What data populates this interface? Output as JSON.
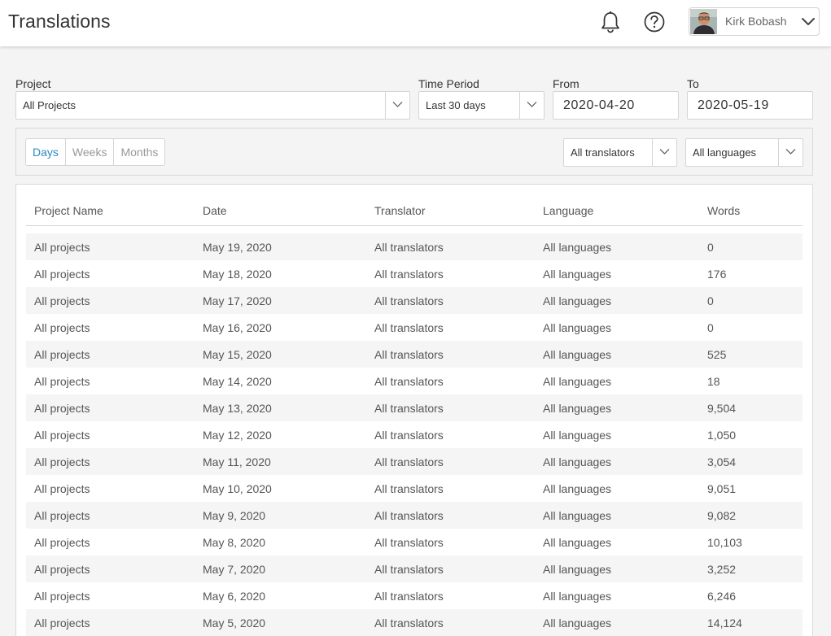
{
  "header": {
    "title": "Translations",
    "user_name": "Kirk Bobash"
  },
  "filters": {
    "project_label": "Project",
    "project_value": "All Projects",
    "time_period_label": "Time Period",
    "time_period_value": "Last 30 days",
    "from_label": "From",
    "from_value": "2020-04-20",
    "to_label": "To",
    "to_value": "2020-05-19"
  },
  "granularity": {
    "options": [
      "Days",
      "Weeks",
      "Months"
    ],
    "selected": "Days"
  },
  "translator_filter": "All translators",
  "language_filter": "All languages",
  "table": {
    "columns": [
      "Project Name",
      "Date",
      "Translator",
      "Language",
      "Words"
    ],
    "rows": [
      [
        "All projects",
        "May 19, 2020",
        "All translators",
        "All languages",
        "0"
      ],
      [
        "All projects",
        "May 18, 2020",
        "All translators",
        "All languages",
        "176"
      ],
      [
        "All projects",
        "May 17, 2020",
        "All translators",
        "All languages",
        "0"
      ],
      [
        "All projects",
        "May 16, 2020",
        "All translators",
        "All languages",
        "0"
      ],
      [
        "All projects",
        "May 15, 2020",
        "All translators",
        "All languages",
        "525"
      ],
      [
        "All projects",
        "May 14, 2020",
        "All translators",
        "All languages",
        "18"
      ],
      [
        "All projects",
        "May 13, 2020",
        "All translators",
        "All languages",
        "9,504"
      ],
      [
        "All projects",
        "May 12, 2020",
        "All translators",
        "All languages",
        "1,050"
      ],
      [
        "All projects",
        "May 11, 2020",
        "All translators",
        "All languages",
        "3,054"
      ],
      [
        "All projects",
        "May 10, 2020",
        "All translators",
        "All languages",
        "9,051"
      ],
      [
        "All projects",
        "May 9, 2020",
        "All translators",
        "All languages",
        "9,082"
      ],
      [
        "All projects",
        "May 8, 2020",
        "All translators",
        "All languages",
        "10,103"
      ],
      [
        "All projects",
        "May 7, 2020",
        "All translators",
        "All languages",
        "3,252"
      ],
      [
        "All projects",
        "May 6, 2020",
        "All translators",
        "All languages",
        "6,246"
      ],
      [
        "All projects",
        "May 5, 2020",
        "All translators",
        "All languages",
        "14,124"
      ]
    ]
  },
  "icons": {
    "notifications": "bell-icon",
    "help": "help-circle-icon",
    "dropdown": "chevron-down-icon"
  },
  "colors": {
    "accent": "#2a8bbf",
    "background": "#f4f4f4",
    "row_stripe": "#f5f5f5"
  }
}
